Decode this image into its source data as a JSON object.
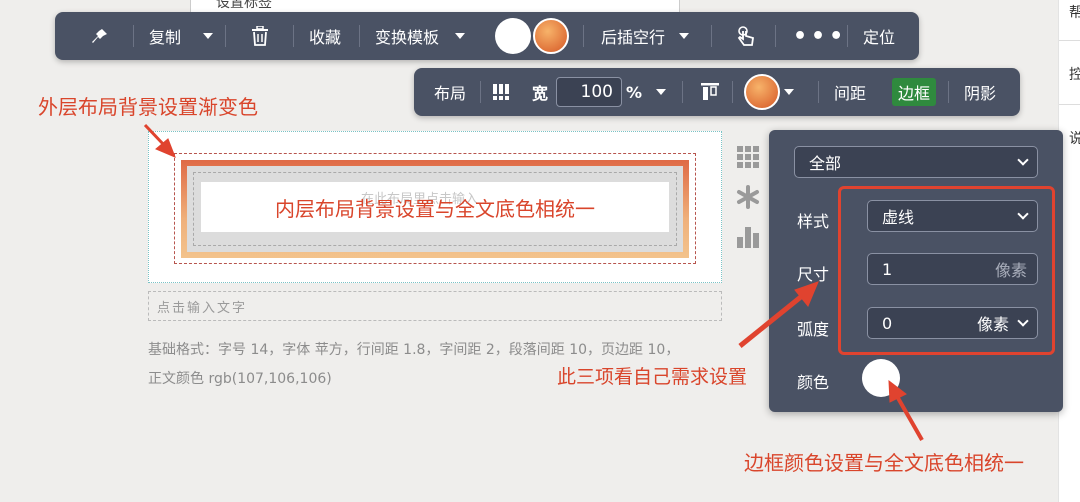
{
  "top_strip": {
    "text": "设置标签"
  },
  "right_edge": {
    "tabs": [
      "帮",
      "控",
      "说"
    ]
  },
  "toolbar1": {
    "copy_label": "复制",
    "collect_label": "收藏",
    "template_label": "变换模板",
    "insert_label": "后插空行",
    "more_label": "•••",
    "locate_label": "定位"
  },
  "toolbar2": {
    "layout_label": "布局",
    "width_label": "宽",
    "width_value": "100",
    "width_unit": "%",
    "spacing_label": "间距",
    "border_label": "边框",
    "shadow_label": "阴影"
  },
  "annotations": {
    "outer": "外层布局背景设置渐变色",
    "inner": "内层布局背景设置与全文底色相统一",
    "three": "此三项看自己需求设置",
    "color": "边框颜色设置与全文底色相统一"
  },
  "content": {
    "ghost_text": "在此布局里点击输入",
    "input_placeholder": "点击输入文字",
    "basic_format_line1": "基础格式：字号 14，字体 苹方，行间距 1.8，字间距 2，段落间距 10，页边距 10，",
    "basic_format_line2": "正文颜色 rgb(107,106,106)"
  },
  "panel": {
    "scope_value": "全部",
    "style_label": "样式",
    "style_value": "虚线",
    "size_label": "尺寸",
    "size_value": "1",
    "size_unit": "像素",
    "radius_label": "弧度",
    "radius_value": "0",
    "radius_unit": "像素",
    "color_label": "颜色"
  },
  "icons": [
    "pin-icon",
    "trash-icon",
    "touch-icon",
    "grid-icon",
    "asterisk-icon",
    "chart-icon"
  ],
  "colors": {
    "toolbar_bg": "#4a5264",
    "annotation_red": "#d9452b",
    "active_green": "#2f8a3e",
    "orange": "#e0733a"
  }
}
